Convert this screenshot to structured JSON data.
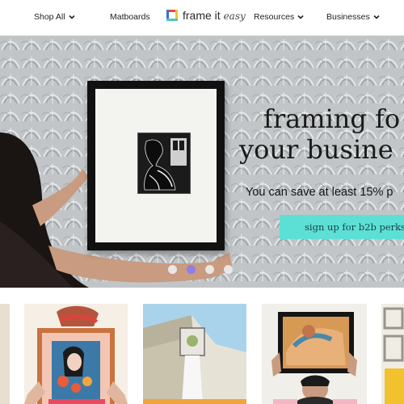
{
  "nav": {
    "shop_all": "Shop All",
    "matboards": "Matboards",
    "logo_main": "frame it",
    "logo_accent": "easy",
    "resources": "Resources",
    "businesses": "Businesses"
  },
  "hero": {
    "title_line1": "framing fo",
    "title_line2": "your busine",
    "subtitle": "You can save at least 15% p",
    "cta_label": "sign up for b2b perks",
    "slide_count": 4,
    "active_slide": 2
  },
  "colors": {
    "accent": "#5ce0d6",
    "active_dot": "#8f7fe8",
    "logo_red": "#e84a3a",
    "logo_blue": "#3a6fd8",
    "logo_yellow": "#f2c12e",
    "logo_teal": "#4fc6b8"
  },
  "icons": {
    "chevron": "chevron-down-icon",
    "logo": "frame-it-easy-logo-icon"
  }
}
